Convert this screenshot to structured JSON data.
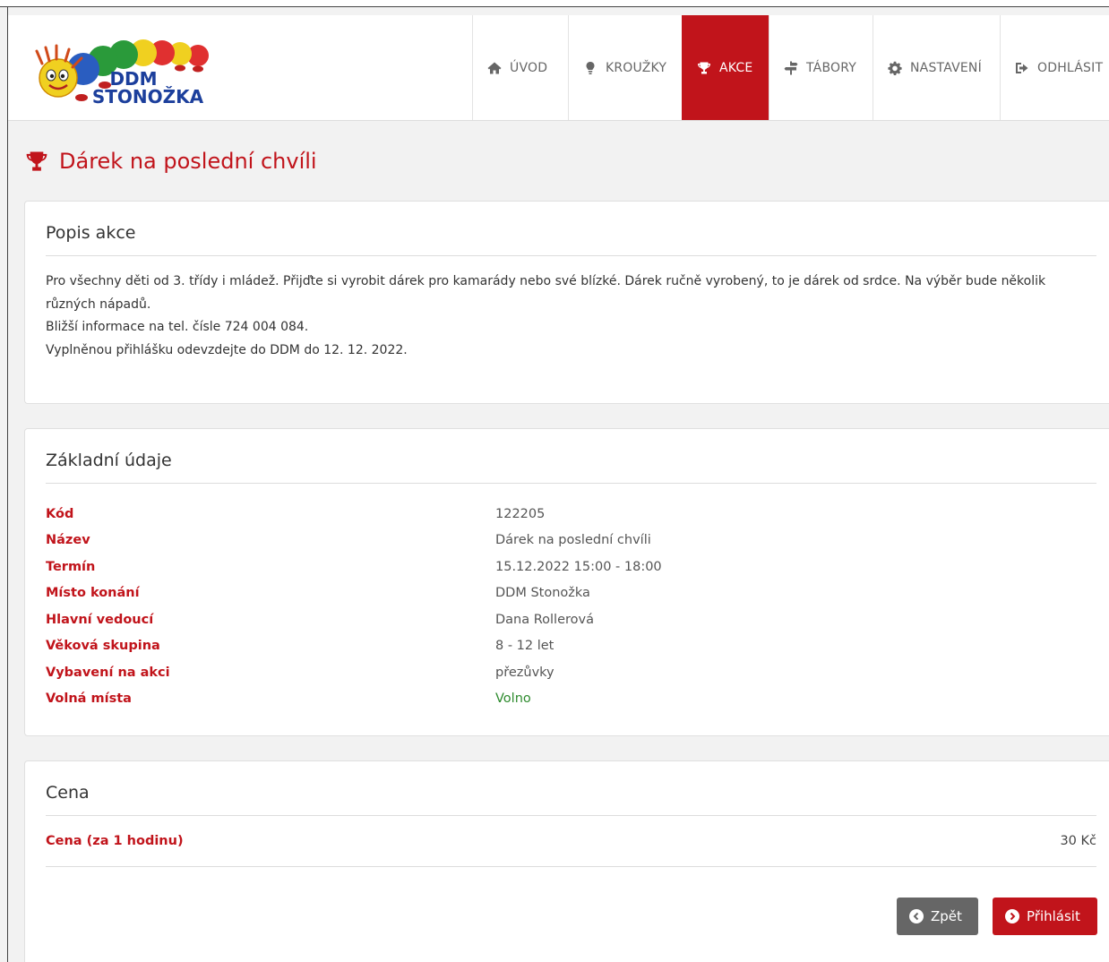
{
  "header": {
    "logo": {
      "line1": "DDM",
      "line2": "STONOŽKA"
    },
    "nav": [
      {
        "label": "ÚVOD",
        "icon": "home-icon"
      },
      {
        "label": "KROUŽKY",
        "icon": "lightbulb-icon"
      },
      {
        "label": "AKCE",
        "icon": "trophy-icon",
        "active": true
      },
      {
        "label": "TÁBORY",
        "icon": "signpost-icon"
      },
      {
        "label": "NASTAVENÍ",
        "icon": "gear-icon"
      },
      {
        "label": "ODHLÁSIT",
        "icon": "sign-out-icon"
      }
    ]
  },
  "page": {
    "title": "Dárek na poslední chvíli",
    "title_icon": "trophy-icon"
  },
  "description": {
    "heading": "Popis akce",
    "lines": [
      "Pro všechny děti od 3. třídy i mládež. Přijďte si vyrobit dárek pro kamarády nebo své blízké. Dárek ručně vyrobený, to je dárek od srdce. Na výběr bude několik různých nápadů.",
      "Bližší informace na tel. čísle 724 004 084.",
      "Vyplněnou přihlášku odevzdejte do DDM do 12. 12. 2022."
    ]
  },
  "basic": {
    "heading": "Základní údaje",
    "rows": [
      {
        "label": "Kód",
        "value": "122205"
      },
      {
        "label": "Název",
        "value": "Dárek na poslední chvíli"
      },
      {
        "label": "Termín",
        "value": "15.12.2022 15:00 - 18:00"
      },
      {
        "label": "Místo konání",
        "value": "DDM Stonožka"
      },
      {
        "label": "Hlavní vedoucí",
        "value": "Dana Rollerová"
      },
      {
        "label": "Věková skupina",
        "value": "8 - 12 let"
      },
      {
        "label": "Vybavení na akci",
        "value": "přezůvky"
      },
      {
        "label": "Volná místa",
        "value": "Volno"
      }
    ]
  },
  "price": {
    "heading": "Cena",
    "label": "Cena (za 1 hodinu)",
    "value": "30 Kč"
  },
  "buttons": {
    "back": "Zpět",
    "signin": "Přihlásit"
  },
  "colors": {
    "accent": "#c1141b",
    "available": "#2e8b2e",
    "back_button": "#666666"
  }
}
